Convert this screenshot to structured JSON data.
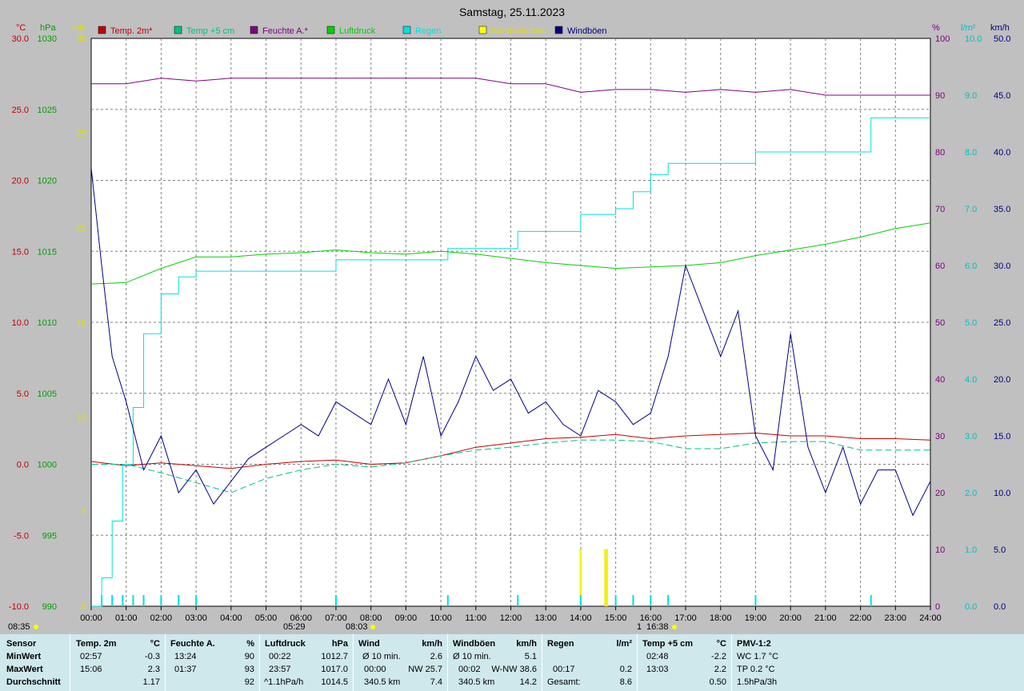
{
  "chart_data": {
    "type": "line",
    "title": "Samstag, 25.11.2023",
    "x_ticks": [
      "00:00",
      "01:00",
      "02:00",
      "03:00",
      "04:00",
      "05:00",
      "06:00",
      "07:00",
      "08:00",
      "09:00",
      "10:00",
      "11:00",
      "12:00",
      "13:00",
      "14:00",
      "15:00",
      "16:00",
      "17:00",
      "18:00",
      "19:00",
      "20:00",
      "21:00",
      "22:00",
      "23:00",
      "24:00"
    ],
    "xlim": [
      0,
      24
    ],
    "grid": true,
    "legend": [
      "Temp. 2m*",
      "Temp +5 cm",
      "Feuchte A.*",
      "Luftdruck",
      "Regen",
      "Sonnenschein",
      "Windböen"
    ],
    "axes": {
      "temp": {
        "unit": "°C",
        "ylim": [
          -10,
          30
        ],
        "ticks": [
          "30.0",
          "25.0",
          "20.0",
          "15.0",
          "10.0",
          "5.0",
          "0.0",
          "-5.0",
          "-10.0"
        ]
      },
      "pressure": {
        "unit": "hPa",
        "ylim": [
          990,
          1030
        ],
        "ticks": [
          "1030",
          "1025",
          "1020",
          "1015",
          "1010",
          "1005",
          "1000",
          "995",
          "990"
        ]
      },
      "sun": {
        "unit": "min",
        "ylim": [
          0,
          30
        ],
        "ticks": [
          "30",
          "25",
          "20",
          "15",
          "10",
          "5",
          "0"
        ]
      },
      "humidity": {
        "unit": "%",
        "ylim": [
          0,
          100
        ],
        "ticks": [
          "100",
          "90",
          "80",
          "70",
          "60",
          "50",
          "40",
          "30",
          "20",
          "10",
          "0"
        ]
      },
      "rain": {
        "unit": "l/m²",
        "ylim": [
          0,
          10
        ],
        "ticks": [
          "10.0",
          "9.0",
          "8.0",
          "7.0",
          "6.0",
          "5.0",
          "4.0",
          "3.0",
          "2.0",
          "1.0",
          "0.0"
        ]
      },
      "wind": {
        "unit": "km/h",
        "ylim": [
          0,
          50
        ],
        "ticks": [
          "50.0",
          "45.0",
          "40.0",
          "35.0",
          "30.0",
          "25.0",
          "20.0",
          "15.0",
          "10.0",
          "5.0",
          "0.0"
        ]
      }
    },
    "series": [
      {
        "name": "Temp. 2m*",
        "color": "#c00000",
        "x": [
          0,
          1,
          2,
          3,
          4,
          5,
          6,
          7,
          8,
          9,
          10,
          11,
          12,
          13,
          14,
          15,
          16,
          17,
          18,
          19,
          20,
          21,
          22,
          23,
          24
        ],
        "values": [
          0.2,
          -0.1,
          0.1,
          -0.1,
          -0.3,
          0,
          0.2,
          0.3,
          0,
          0.1,
          0.6,
          1.2,
          1.5,
          1.8,
          1.9,
          2.1,
          1.8,
          2.0,
          2.1,
          2.2,
          2.0,
          2.0,
          1.8,
          1.8,
          1.7
        ]
      },
      {
        "name": "Temp +5 cm",
        "color": "#00c080",
        "x": [
          0,
          1,
          2,
          3,
          4,
          5,
          6,
          7,
          8,
          9,
          10,
          11,
          12,
          13,
          14,
          15,
          16,
          17,
          18,
          19,
          20,
          21,
          22,
          23,
          24
        ],
        "values": [
          0,
          0,
          -0.6,
          -1.3,
          -2.0,
          -1.0,
          -0.4,
          0,
          -0.2,
          0.1,
          0.6,
          1.0,
          1.2,
          1.5,
          1.7,
          1.7,
          1.6,
          1.1,
          1.1,
          1.5,
          1.6,
          1.6,
          1.0,
          1.0,
          1.0
        ]
      },
      {
        "name": "Feuchte A.*",
        "color": "#800080",
        "x": [
          0,
          1,
          2,
          3,
          4,
          5,
          6,
          7,
          8,
          9,
          10,
          11,
          12,
          13,
          14,
          15,
          16,
          17,
          18,
          19,
          20,
          21,
          22,
          23,
          24
        ],
        "values": [
          92,
          92,
          93,
          92.5,
          93,
          93,
          93,
          93,
          93,
          93,
          93,
          93,
          92,
          92,
          90.5,
          91,
          91,
          90.5,
          91,
          90.5,
          91,
          90,
          90,
          90,
          90
        ]
      },
      {
        "name": "Luftdruck",
        "color": "#00d000",
        "x": [
          0,
          1,
          2,
          3,
          4,
          5,
          6,
          7,
          8,
          9,
          10,
          11,
          12,
          13,
          14,
          15,
          16,
          17,
          18,
          19,
          20,
          21,
          22,
          23,
          24
        ],
        "values": [
          1012.7,
          1012.8,
          1013.8,
          1014.6,
          1014.6,
          1014.8,
          1014.9,
          1015.1,
          1014.9,
          1014.8,
          1015,
          1014.8,
          1014.5,
          1014.2,
          1014,
          1013.8,
          1013.9,
          1014.0,
          1014.2,
          1014.7,
          1015.1,
          1015.5,
          1016.0,
          1016.6,
          1017.0
        ]
      },
      {
        "name": "Regen",
        "color": "#00e0e0",
        "x": [
          0,
          0.3,
          0.6,
          0.9,
          1.2,
          1.5,
          2.0,
          2.5,
          3.0,
          5.0,
          7.0,
          8.0,
          10.0,
          10.2,
          12.0,
          12.2,
          13.0,
          14.0,
          15.0,
          15.5,
          16.0,
          16.5,
          18.0,
          19.0,
          20.0,
          21.0,
          22.0,
          22.3,
          23.0,
          24.0
        ],
        "values": [
          0,
          0.5,
          1.5,
          2.5,
          3.5,
          4.8,
          5.5,
          5.8,
          5.9,
          5.9,
          6.1,
          6.1,
          6.1,
          6.3,
          6.3,
          6.6,
          6.6,
          6.9,
          7.0,
          7.3,
          7.6,
          7.8,
          7.8,
          8.0,
          8.0,
          8.0,
          8.0,
          8.6,
          8.6,
          8.6
        ]
      },
      {
        "name": "Windböen",
        "color": "#000080",
        "x": [
          0,
          0.3,
          0.6,
          1,
          1.5,
          2,
          2.5,
          3,
          3.5,
          4,
          4.5,
          5,
          5.5,
          6,
          6.5,
          7,
          7.5,
          8,
          8.5,
          9,
          9.5,
          10,
          10.5,
          11,
          11.5,
          12,
          12.5,
          13,
          13.5,
          14,
          14.5,
          15,
          15.5,
          16,
          16.5,
          17,
          17.5,
          18,
          18.5,
          19,
          19.5,
          20,
          20.5,
          21,
          21.5,
          22,
          22.5,
          23,
          23.5,
          24
        ],
        "values": [
          38.6,
          30,
          22,
          18,
          12,
          15,
          10,
          12,
          9,
          11,
          13,
          14,
          15,
          16,
          15,
          18,
          17,
          16,
          20,
          16,
          22,
          15,
          18,
          22,
          19,
          20,
          17,
          18,
          16,
          15,
          19,
          18,
          16,
          17,
          22,
          30,
          26,
          22,
          26,
          15,
          12,
          24,
          14,
          10,
          14,
          9,
          12,
          12,
          8,
          11
        ]
      },
      {
        "name": "Sonnenschein",
        "color": "#ffff00",
        "x": [
          14.0,
          14.7,
          14.75
        ],
        "values": [
          3,
          3,
          3
        ]
      }
    ],
    "extra_labels": [
      "08:35",
      "05:29",
      "08:03",
      "16:38",
      "1"
    ]
  },
  "stats": {
    "headers": [
      {
        "label": "Sensor",
        "unit": ""
      },
      {
        "label": "Temp. 2m",
        "unit": "°C"
      },
      {
        "label": "Feuchte A.",
        "unit": "%"
      },
      {
        "label": "Luftdruck",
        "unit": "hPa"
      },
      {
        "label": "Wind",
        "unit": "km/h"
      },
      {
        "label": "Windböen",
        "unit": "km/h"
      },
      {
        "label": "Regen",
        "unit": "l/m²"
      },
      {
        "label": "Temp +5 cm",
        "unit": "°C"
      },
      {
        "label": "PMV-1:2",
        "unit": ""
      }
    ],
    "row_labels": [
      "MinWert",
      "MaxWert",
      "Durchschnitt"
    ],
    "temp2m": [
      {
        "time": "02:57",
        "value": "-0.3"
      },
      {
        "time": "15:06",
        "value": "2.3"
      },
      {
        "time": "",
        "value": "1.17"
      }
    ],
    "feuchte": [
      {
        "time": "13:24",
        "value": "90"
      },
      {
        "time": "01:37",
        "value": "93"
      },
      {
        "time": "",
        "value": "92"
      }
    ],
    "luftdruck": [
      {
        "time": "00:22",
        "value": "1012.7"
      },
      {
        "time": "23:57",
        "value": "1017.0"
      },
      {
        "time": "^1.1hPa/h",
        "value": "1014.5"
      }
    ],
    "wind": [
      {
        "time": "Ø 10 min.",
        "value": "2.6"
      },
      {
        "time": "00:00",
        "value": "NW 25.7"
      },
      {
        "time": "340.5 km",
        "value": "7.4"
      }
    ],
    "boeen": [
      {
        "time": "Ø 10 min.",
        "value": "5.1"
      },
      {
        "time": "00:02",
        "value": "W-NW 38.6"
      },
      {
        "time": "340.5 km",
        "value": "14.2"
      }
    ],
    "regen": [
      {
        "time": "",
        "value": ""
      },
      {
        "time": "00:17",
        "value": "0.2"
      },
      {
        "time": "Gesamt:",
        "value": "8.6"
      }
    ],
    "temp5cm": [
      {
        "time": "02:48",
        "value": "-2.2"
      },
      {
        "time": "13:03",
        "value": "2.2"
      },
      {
        "time": "",
        "value": "0.50"
      }
    ],
    "pmv": [
      "WC 1.7 °C",
      "TP 0.2 °C",
      "1.5hPa/3h"
    ]
  }
}
